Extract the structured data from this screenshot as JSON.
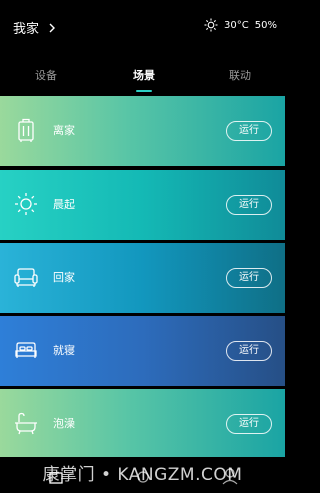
{
  "header": {
    "title": "我家",
    "temperature": "30°C",
    "humidity": "50%"
  },
  "tabs": [
    {
      "label": "设备"
    },
    {
      "label": "场景"
    },
    {
      "label": "联动"
    }
  ],
  "scenes": [
    {
      "label": "离家",
      "icon": "luggage-icon",
      "button": "运行"
    },
    {
      "label": "晨起",
      "icon": "sun-icon",
      "button": "运行"
    },
    {
      "label": "回家",
      "icon": "sofa-icon",
      "button": "运行"
    },
    {
      "label": "就寝",
      "icon": "bed-icon",
      "button": "运行"
    },
    {
      "label": "泡澡",
      "icon": "bathtub-icon",
      "button": "运行"
    }
  ],
  "watermark": "康掌门 • KANGZM.COM",
  "colors": {
    "accent": "#2ccfc4",
    "background": "#000000"
  }
}
